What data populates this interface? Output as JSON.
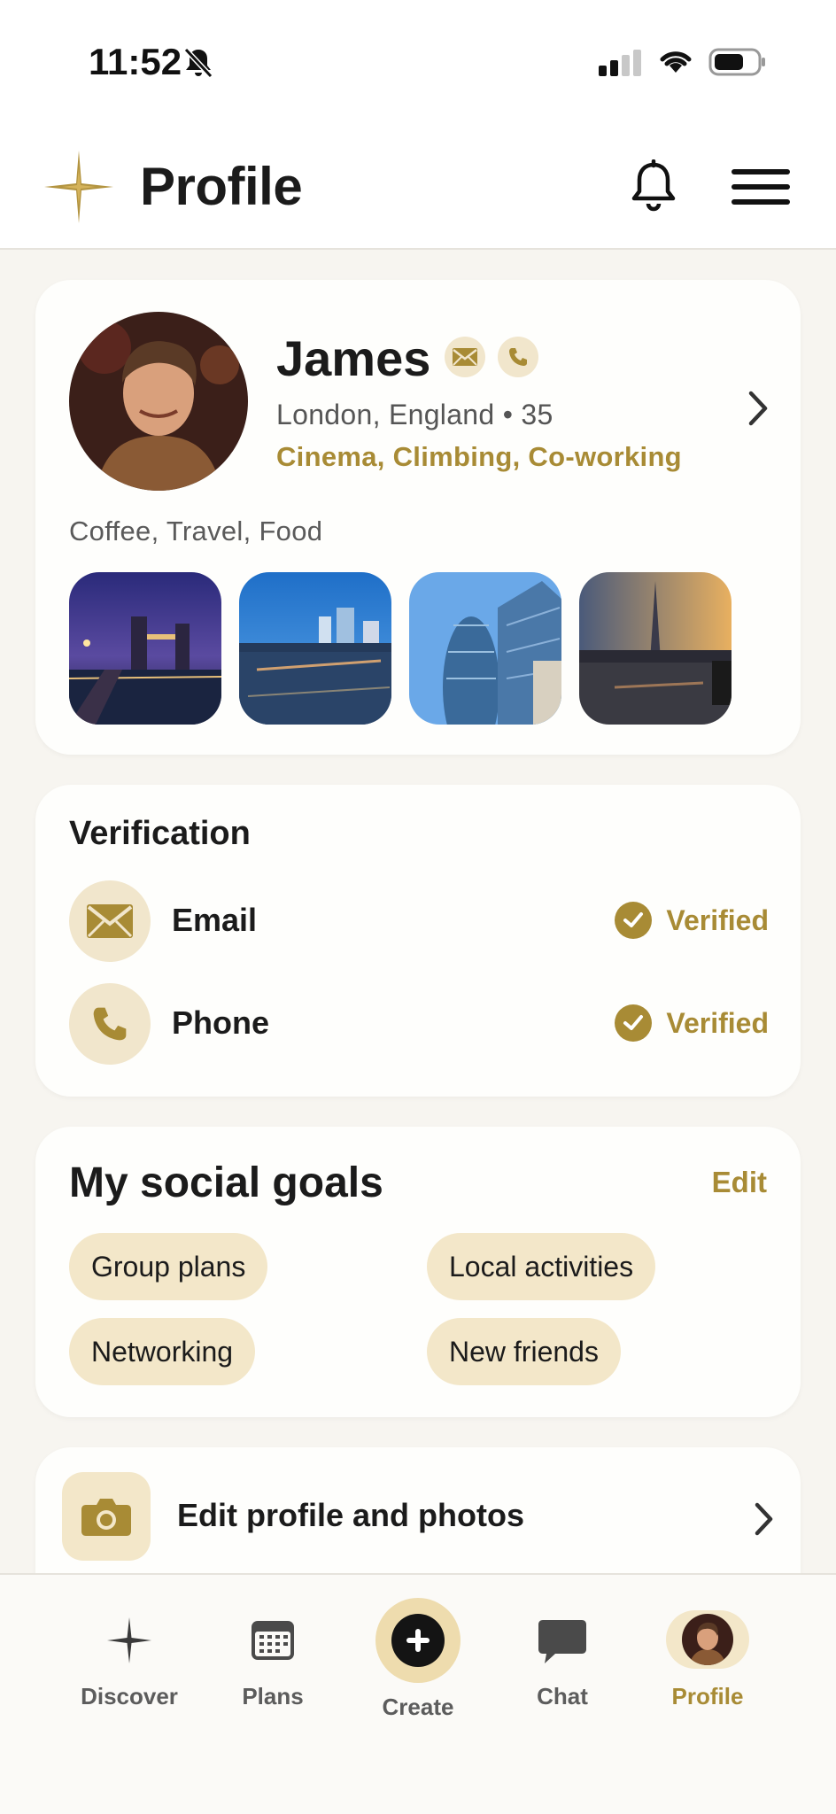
{
  "status_bar": {
    "time": "11:52"
  },
  "header": {
    "title": "Profile"
  },
  "profile": {
    "name": "James",
    "location": "London, England • 35",
    "interests": "Cinema, Climbing, Co-working",
    "tags": "Coffee, Travel, Food"
  },
  "verification": {
    "title": "Verification",
    "items": [
      {
        "label": "Email",
        "status": "Verified"
      },
      {
        "label": "Phone",
        "status": "Verified"
      }
    ]
  },
  "goals": {
    "title": "My social goals",
    "edit_label": "Edit",
    "chips": [
      "Group plans",
      "Local activities",
      "Networking",
      "New friends"
    ]
  },
  "edit_profile": {
    "label": "Edit profile and photos"
  },
  "nav": {
    "items": [
      {
        "label": "Discover"
      },
      {
        "label": "Plans"
      },
      {
        "label": "Create"
      },
      {
        "label": "Chat"
      },
      {
        "label": "Profile"
      }
    ]
  },
  "colors": {
    "accent": "#a88b35",
    "accent_soft": "#f3e7c9",
    "background": "#f7f5f0",
    "card": "#fefefc"
  }
}
